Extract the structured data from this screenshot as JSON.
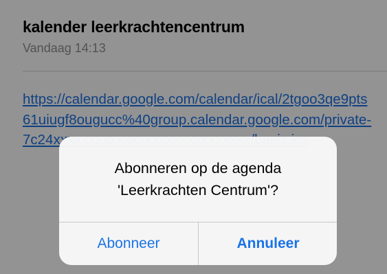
{
  "email": {
    "subject": "kalender leerkrachtencentrum",
    "date": "Vandaag 14:13",
    "link_text": "https://calendar.google.com/calendar/ical/2tgoo3qe9pts61uiugf8ougucc%40group.calendar.google.com/private-7c24xxxxxxxxxxxxxxxxxxxxxxxxxxxx/basic.ics"
  },
  "alert": {
    "title_line1": "Abonneren op de agenda",
    "title_line2": "'Leerkrachten Centrum'?",
    "subscribe_label": "Abonneer",
    "cancel_label": "Annuleer"
  },
  "colors": {
    "link": "#1a6fe0",
    "button": "#1a73e8",
    "overlay": "rgba(0,0,0,0.42)"
  }
}
